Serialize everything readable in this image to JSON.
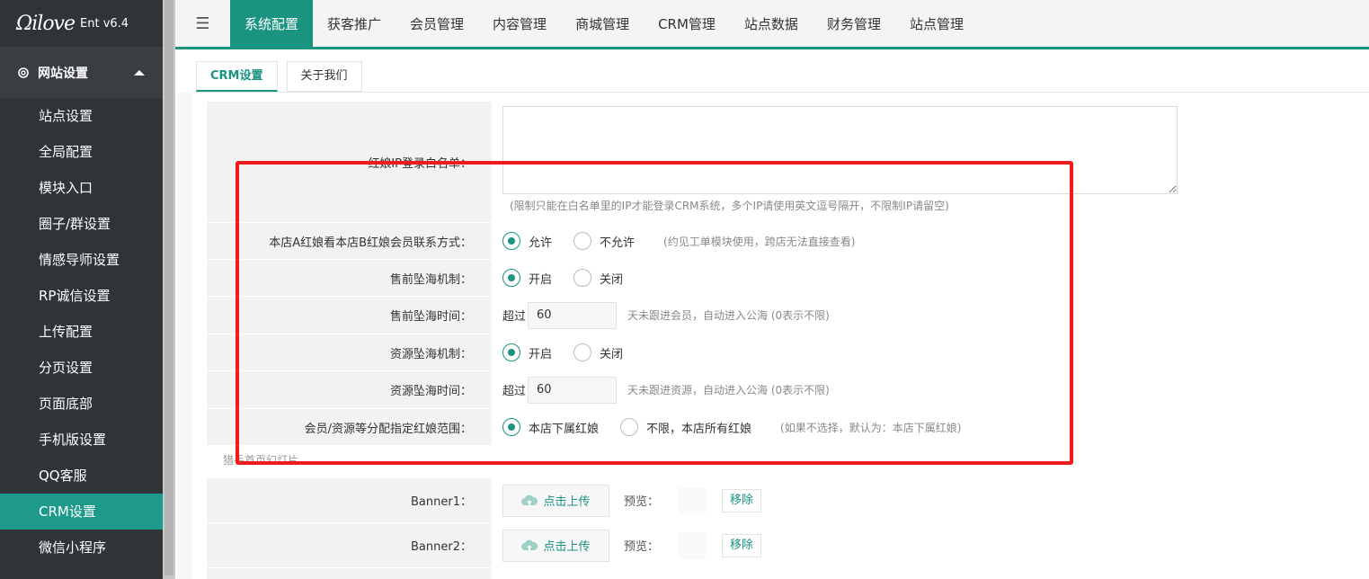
{
  "logo": {
    "script": "Ωilove",
    "version": "Ent v6.4"
  },
  "sidebar": {
    "group_label": "网站设置",
    "items": [
      {
        "label": "站点设置"
      },
      {
        "label": "全局配置"
      },
      {
        "label": "模块入口"
      },
      {
        "label": "圈子/群设置"
      },
      {
        "label": "情感导师设置"
      },
      {
        "label": "RP诚信设置"
      },
      {
        "label": "上传配置"
      },
      {
        "label": "分页设置"
      },
      {
        "label": "页面底部"
      },
      {
        "label": "手机版设置"
      },
      {
        "label": "QQ客服"
      },
      {
        "label": "CRM设置"
      },
      {
        "label": "微信小程序"
      }
    ],
    "active_index": 11
  },
  "topnav": {
    "tabs": [
      {
        "label": "系统配置"
      },
      {
        "label": "获客推广"
      },
      {
        "label": "会员管理"
      },
      {
        "label": "内容管理"
      },
      {
        "label": "商城管理"
      },
      {
        "label": "CRM管理"
      },
      {
        "label": "站点数据"
      },
      {
        "label": "财务管理"
      },
      {
        "label": "站点管理"
      }
    ],
    "active_index": 0
  },
  "subtabs": [
    {
      "label": "CRM设置"
    },
    {
      "label": "关于我们"
    }
  ],
  "form": {
    "whitelist": {
      "label": "红娘IP登录白名单：",
      "hint": "(限制只能在白名单里的IP才能登录CRM系统，多个IP请使用英文逗号隔开，不限制IP请留空)"
    },
    "cross_store": {
      "label": "本店A红娘看本店B红娘会员联系方式：",
      "opt_on": "允许",
      "opt_off": "不允许",
      "hint": "(约见工单模块使用，跨店无法直接查看)"
    },
    "presale_pool": {
      "label": "售前坠海机制：",
      "opt_on": "开启",
      "opt_off": "关闭"
    },
    "presale_time": {
      "label": "售前坠海时间：",
      "prefix": "超过",
      "value": "60",
      "hint": "天未跟进会员，自动进入公海 (0表示不限)"
    },
    "resource_pool": {
      "label": "资源坠海机制：",
      "opt_on": "开启",
      "opt_off": "关闭"
    },
    "resource_time": {
      "label": "资源坠海时间：",
      "prefix": "超过",
      "value": "60",
      "hint": "天未跟进资源，自动进入公海 (0表示不限)"
    },
    "assign_range": {
      "label": "会员/资源等分配指定红娘范围：",
      "opt_on": "本店下属红娘",
      "opt_off": "不限，本店所有红娘",
      "hint": "(如果不选择，默认为：本店下属红娘)"
    },
    "section_title": "猎手首页幻灯片",
    "banners": [
      {
        "label": "Banner1：",
        "upload": "点击上传",
        "preview": "预览：",
        "remove": "移除"
      },
      {
        "label": "Banner2：",
        "upload": "点击上传",
        "preview": "预览：",
        "remove": "移除"
      }
    ]
  },
  "colors": {
    "accent": "#1a9480",
    "highlight_box": "#ee1c1c",
    "sidebar_bg": "#2f3438"
  }
}
